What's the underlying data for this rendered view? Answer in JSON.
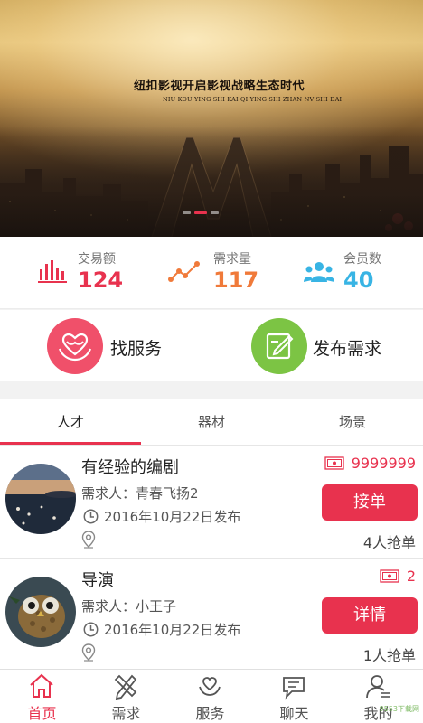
{
  "banner": {
    "slogan_cn": "纽扣影视开启影视战略生态时代",
    "slogan_en": "NIU KOU YING SHI KAI QI YING SHI ZHAN NV SHI DAI",
    "slide_count": 3,
    "active_slide": 2
  },
  "stats": [
    {
      "label": "交易额",
      "value": "124",
      "color": "#e8324e",
      "icon": "bar-chart-icon"
    },
    {
      "label": "需求量",
      "value": "117",
      "color": "#f07a3a",
      "icon": "trend-line-icon"
    },
    {
      "label": "会员数",
      "value": "40",
      "color": "#38b4e4",
      "icon": "members-icon"
    }
  ],
  "actions": [
    {
      "label": "找服务",
      "icon": "heart-hand-icon",
      "color": "#f0506a"
    },
    {
      "label": "发布需求",
      "icon": "edit-note-icon",
      "color": "#7cc444"
    }
  ],
  "tabs": [
    {
      "label": "人才",
      "active": true
    },
    {
      "label": "器材",
      "active": false
    },
    {
      "label": "场景",
      "active": false
    }
  ],
  "list": [
    {
      "title": "有经验的编剧",
      "requester": "需求人：青春飞扬2",
      "date": "2016年10月22日发布",
      "price": "9999999",
      "button": "接单",
      "grab": "4人抢单",
      "avatar": "seaside-sunset-avatar"
    },
    {
      "title": "导演",
      "requester": "需求人：小王子",
      "date": "2016年10月22日发布",
      "price": "2",
      "button": "详情",
      "grab": "1人抢单",
      "avatar": "cartoon-owl-avatar"
    }
  ],
  "bottom_nav": [
    {
      "label": "首页",
      "icon": "home-icon",
      "active": true
    },
    {
      "label": "需求",
      "icon": "pencil-ruler-icon",
      "active": false
    },
    {
      "label": "服务",
      "icon": "heart-hand-icon",
      "active": false
    },
    {
      "label": "聊天",
      "icon": "chat-bubble-icon",
      "active": false
    },
    {
      "label": "我的",
      "icon": "user-icon",
      "active": false
    }
  ],
  "watermark": "9553下载网"
}
